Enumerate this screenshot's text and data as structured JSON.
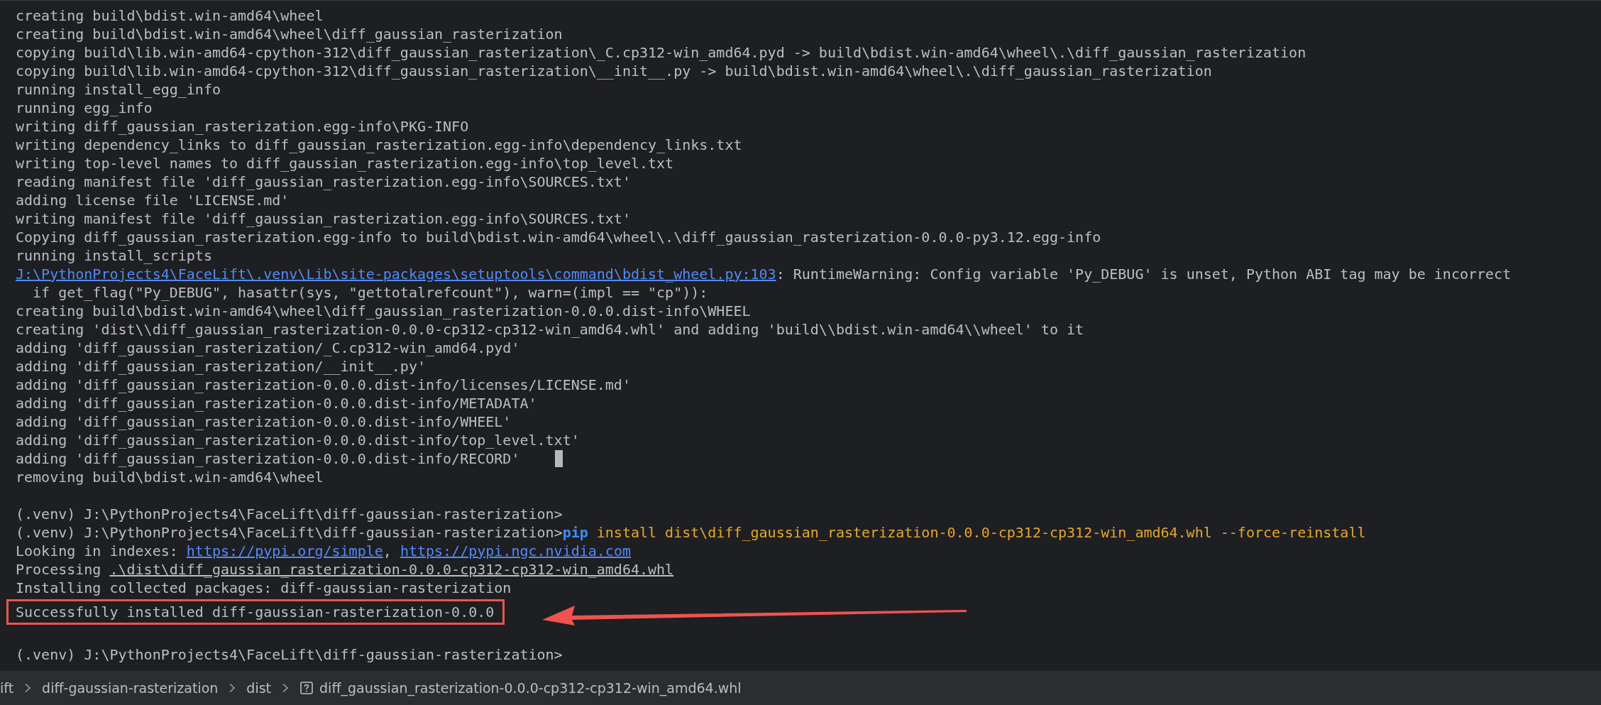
{
  "terminal": {
    "lines": [
      {
        "kind": "output",
        "segments": [
          {
            "kind": "plain",
            "text": "creating build\\bdist.win-amd64\\wheel"
          }
        ]
      },
      {
        "kind": "output",
        "segments": [
          {
            "kind": "plain",
            "text": "creating build\\bdist.win-amd64\\wheel\\diff_gaussian_rasterization"
          }
        ]
      },
      {
        "kind": "output",
        "segments": [
          {
            "kind": "plain",
            "text": "copying build\\lib.win-amd64-cpython-312\\diff_gaussian_rasterization\\_C.cp312-win_amd64.pyd -> build\\bdist.win-amd64\\wheel\\.\\diff_gaussian_rasterization"
          }
        ]
      },
      {
        "kind": "output",
        "segments": [
          {
            "kind": "plain",
            "text": "copying build\\lib.win-amd64-cpython-312\\diff_gaussian_rasterization\\__init__.py -> build\\bdist.win-amd64\\wheel\\.\\diff_gaussian_rasterization"
          }
        ]
      },
      {
        "kind": "output",
        "segments": [
          {
            "kind": "plain",
            "text": "running install_egg_info"
          }
        ]
      },
      {
        "kind": "output",
        "segments": [
          {
            "kind": "plain",
            "text": "running egg_info"
          }
        ]
      },
      {
        "kind": "output",
        "segments": [
          {
            "kind": "plain",
            "text": "writing diff_gaussian_rasterization.egg-info\\PKG-INFO"
          }
        ]
      },
      {
        "kind": "output",
        "segments": [
          {
            "kind": "plain",
            "text": "writing dependency_links to diff_gaussian_rasterization.egg-info\\dependency_links.txt"
          }
        ]
      },
      {
        "kind": "output",
        "segments": [
          {
            "kind": "plain",
            "text": "writing top-level names to diff_gaussian_rasterization.egg-info\\top_level.txt"
          }
        ]
      },
      {
        "kind": "output",
        "segments": [
          {
            "kind": "plain",
            "text": "reading manifest file 'diff_gaussian_rasterization.egg-info\\SOURCES.txt'"
          }
        ]
      },
      {
        "kind": "output",
        "segments": [
          {
            "kind": "plain",
            "text": "adding license file 'LICENSE.md'"
          }
        ]
      },
      {
        "kind": "output",
        "segments": [
          {
            "kind": "plain",
            "text": "writing manifest file 'diff_gaussian_rasterization.egg-info\\SOURCES.txt'"
          }
        ]
      },
      {
        "kind": "output",
        "segments": [
          {
            "kind": "plain",
            "text": "Copying diff_gaussian_rasterization.egg-info to build\\bdist.win-amd64\\wheel\\.\\diff_gaussian_rasterization-0.0.0-py3.12.egg-info"
          }
        ]
      },
      {
        "kind": "output",
        "segments": [
          {
            "kind": "plain",
            "text": "running install_scripts"
          }
        ]
      },
      {
        "kind": "output",
        "segments": [
          {
            "kind": "link",
            "text": "J:\\PythonProjects4\\FaceLift\\.venv\\Lib\\site-packages\\setuptools\\command\\bdist_wheel.py:103"
          },
          {
            "kind": "plain",
            "text": ": RuntimeWarning: Config variable 'Py_DEBUG' is unset, Python ABI tag may be incorrect"
          }
        ]
      },
      {
        "kind": "output",
        "segments": [
          {
            "kind": "plain",
            "text": "  if get_flag(\"Py_DEBUG\", hasattr(sys, \"gettotalrefcount\"), warn=(impl == \"cp\")):"
          }
        ]
      },
      {
        "kind": "output",
        "segments": [
          {
            "kind": "plain",
            "text": "creating build\\bdist.win-amd64\\wheel\\diff_gaussian_rasterization-0.0.0.dist-info\\WHEEL"
          }
        ]
      },
      {
        "kind": "output",
        "segments": [
          {
            "kind": "plain",
            "text": "creating 'dist\\\\diff_gaussian_rasterization-0.0.0-cp312-cp312-win_amd64.whl' and adding 'build\\\\bdist.win-amd64\\\\wheel' to it"
          }
        ]
      },
      {
        "kind": "output",
        "segments": [
          {
            "kind": "plain",
            "text": "adding 'diff_gaussian_rasterization/_C.cp312-win_amd64.pyd'"
          }
        ]
      },
      {
        "kind": "output",
        "segments": [
          {
            "kind": "plain",
            "text": "adding 'diff_gaussian_rasterization/__init__.py'"
          }
        ]
      },
      {
        "kind": "output",
        "segments": [
          {
            "kind": "plain",
            "text": "adding 'diff_gaussian_rasterization-0.0.0.dist-info/licenses/LICENSE.md'"
          }
        ]
      },
      {
        "kind": "output",
        "segments": [
          {
            "kind": "plain",
            "text": "adding 'diff_gaussian_rasterization-0.0.0.dist-info/METADATA'"
          }
        ]
      },
      {
        "kind": "output",
        "segments": [
          {
            "kind": "plain",
            "text": "adding 'diff_gaussian_rasterization-0.0.0.dist-info/WHEEL'"
          }
        ]
      },
      {
        "kind": "output",
        "segments": [
          {
            "kind": "plain",
            "text": "adding 'diff_gaussian_rasterization-0.0.0.dist-info/top_level.txt'"
          }
        ]
      },
      {
        "kind": "output",
        "segments": [
          {
            "kind": "plain",
            "text": "adding 'diff_gaussian_rasterization-0.0.0.dist-info/RECORD'"
          }
        ],
        "cursor": true
      },
      {
        "kind": "output",
        "segments": [
          {
            "kind": "plain",
            "text": "removing build\\bdist.win-amd64\\wheel"
          }
        ]
      },
      {
        "kind": "blank"
      },
      {
        "kind": "output",
        "segments": [
          {
            "kind": "plain",
            "text": "(.venv) J:\\PythonProjects4\\FaceLift\\diff-gaussian-rasterization>"
          }
        ]
      },
      {
        "kind": "output",
        "segments": [
          {
            "kind": "plain",
            "text": "(.venv) J:\\PythonProjects4\\FaceLift\\diff-gaussian-rasterization>"
          },
          {
            "kind": "command",
            "text": "pip"
          },
          {
            "kind": "argument",
            "text": " install dist\\diff_gaussian_rasterization-0.0.0-cp312-cp312-win_amd64.whl --force-reinstall"
          }
        ]
      },
      {
        "kind": "output",
        "segments": [
          {
            "kind": "plain",
            "text": "Looking in indexes: "
          },
          {
            "kind": "link",
            "text": "https://pypi.org/simple"
          },
          {
            "kind": "plain",
            "text": ", "
          },
          {
            "kind": "link",
            "text": "https://pypi.ngc.nvidia.com"
          }
        ]
      },
      {
        "kind": "output",
        "segments": [
          {
            "kind": "plain",
            "text": "Processing "
          },
          {
            "kind": "path",
            "text": ".\\dist\\diff_gaussian_rasterization-0.0.0-cp312-cp312-win_amd64.whl"
          }
        ]
      },
      {
        "kind": "output",
        "segments": [
          {
            "kind": "plain",
            "text": "Installing collected packages: diff-gaussian-rasterization"
          }
        ]
      },
      {
        "kind": "output",
        "segments": [
          {
            "kind": "plain",
            "text": "Successfully installed diff-gaussian-rasterization-0.0.0"
          }
        ],
        "highlighted": true
      },
      {
        "kind": "blank"
      },
      {
        "kind": "output",
        "segments": [
          {
            "kind": "plain",
            "text": "(.venv) J:\\PythonProjects4\\FaceLift\\diff-gaussian-rasterization>"
          }
        ]
      }
    ]
  },
  "breadcrumb": {
    "items": [
      "ift",
      "diff-gaussian-rasterization",
      "dist",
      "diff_gaussian_rasterization-0.0.0-cp312-cp312-win_amd64.whl"
    ]
  }
}
